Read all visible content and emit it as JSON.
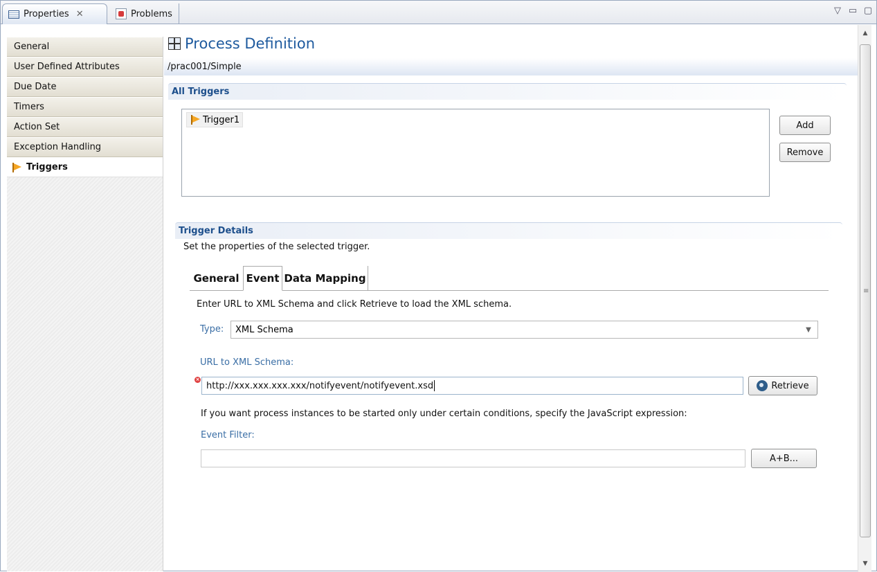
{
  "tabs": {
    "properties_label": "Properties",
    "properties_close": "✕",
    "problems_label": "Problems",
    "view_menu": "▽",
    "minimize": "▭",
    "maximize": "▢"
  },
  "sidebar": {
    "items": [
      {
        "label": "General"
      },
      {
        "label": "User Defined Attributes"
      },
      {
        "label": "Due Date"
      },
      {
        "label": "Timers"
      },
      {
        "label": "Action Set"
      },
      {
        "label": "Exception Handling"
      },
      {
        "label": "Triggers",
        "selected": true
      }
    ]
  },
  "header": {
    "title": "Process Definition",
    "path": "/prac001/Simple"
  },
  "all_triggers": {
    "title": "All Triggers",
    "items": [
      "Trigger1"
    ],
    "add_label": "Add",
    "remove_label": "Remove"
  },
  "details": {
    "title": "Trigger Details",
    "subtitle": "Set the properties of the selected trigger.",
    "tabs": [
      "General",
      "Event",
      "Data Mapping"
    ],
    "selected_tab": "Event",
    "instruction": "Enter URL to XML Schema and click Retrieve to load the XML schema.",
    "type_label": "Type:",
    "type_value": "XML Schema",
    "url_label": "URL to XML Schema:",
    "url_value": "http://xxx.xxx.xxx.xxx/notifyevent/notifyevent.xsd",
    "retrieve_label": "Retrieve",
    "condition_text": "If you want process instances to be started only under certain conditions, specify the JavaScript expression:",
    "filter_label": "Event Filter:",
    "filter_value": "",
    "expr_button_label": "A+B..."
  },
  "icons": {
    "properties_tab": "properties-icon",
    "problems_tab": "problems-icon",
    "triggers": "flag-icon",
    "process_definition": "process-definition-icon",
    "retrieve": "retrieve-icon",
    "error": "error-icon"
  },
  "colors": {
    "title_blue": "#1e5a9e",
    "section_blue": "#1d4f8c",
    "label_blue": "#3a6ea5",
    "error_red": "#e04343",
    "flag_orange": "#f5a623"
  }
}
